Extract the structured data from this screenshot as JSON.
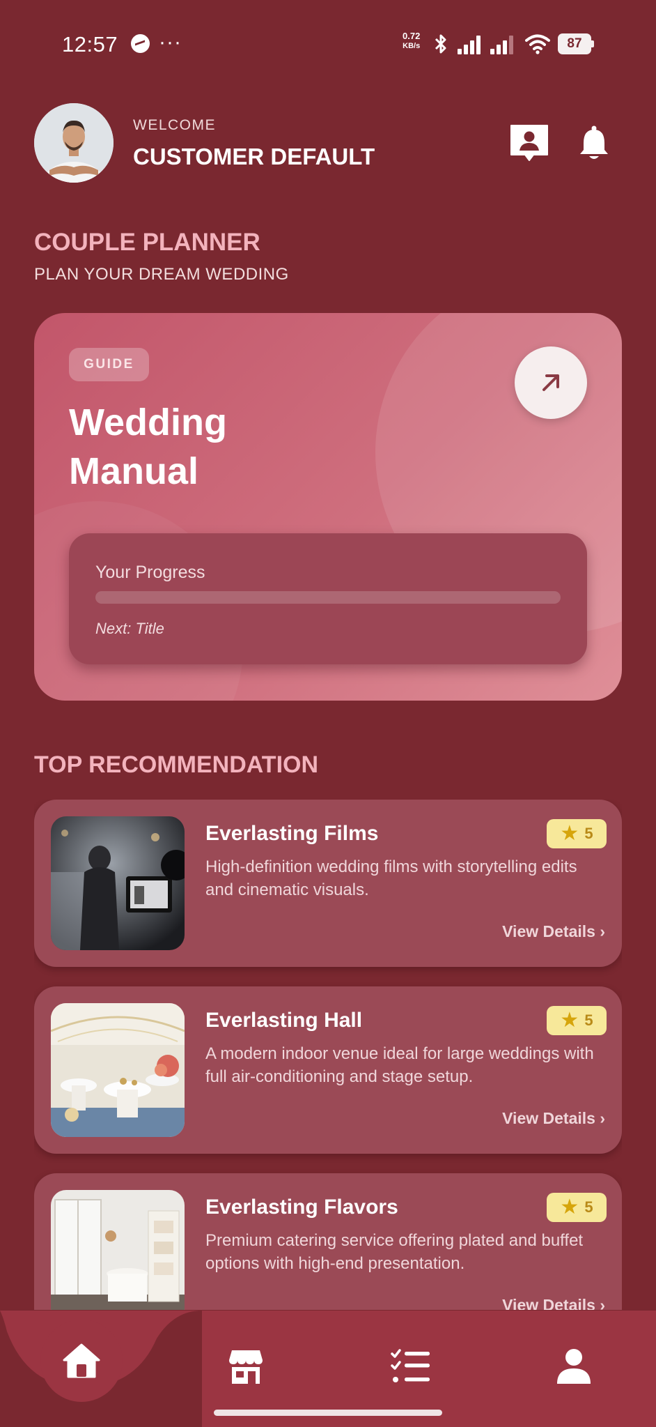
{
  "status_bar": {
    "time": "12:57",
    "dots": "···",
    "net_speed_value": "0.72",
    "net_speed_unit": "KB/s",
    "battery": "87"
  },
  "header": {
    "welcome": "WELCOME",
    "user_name": "CUSTOMER DEFAULT"
  },
  "planner": {
    "title": "COUPLE PLANNER",
    "subtitle": "PLAN YOUR DREAM WEDDING"
  },
  "guide_card": {
    "badge": "GUIDE",
    "title": "Wedding Manual",
    "progress_label": "Your Progress",
    "progress_fraction": 0,
    "next_label": "Next: Title"
  },
  "recommendations": {
    "title": "TOP RECOMMENDATION",
    "items": [
      {
        "name": "Everlasting Films",
        "rating": "5",
        "description": "High-definition wedding films with storytelling edits and cinematic visuals.",
        "link": "View Details ›"
      },
      {
        "name": "Everlasting Hall",
        "rating": "5",
        "description": "A modern indoor venue ideal for large weddings with full air-conditioning and stage setup.",
        "link": "View Details ›"
      },
      {
        "name": "Everlasting Flavors",
        "rating": "5",
        "description": "Premium catering service offering plated and buffet options with high-end presentation.",
        "link": "View Details ›"
      }
    ]
  },
  "bottom_nav": {
    "items": [
      "home-icon",
      "store-icon",
      "checklist-icon",
      "profile-icon"
    ],
    "active": "home-icon"
  },
  "colors": {
    "background": "#7a2830",
    "accent_pink": "#f3b3bd",
    "card": "#9b4a56",
    "rating_badge": "#f7e89a",
    "nav": "#9b3542"
  }
}
